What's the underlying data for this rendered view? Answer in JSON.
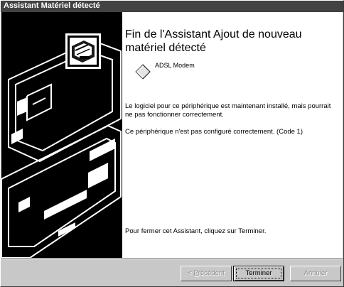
{
  "window": {
    "title": "Assistant Matériel détecté"
  },
  "main": {
    "heading": "Fin de l'Assistant Ajout de nouveau matériel détecté",
    "device_name": "ADSL Modem",
    "paragraph1": "Le logiciel pour ce périphérique est maintenant installé, mais pourrait ne pas fonctionner correctement.",
    "paragraph2": "Ce périphérique n'est pas configuré correctement. (Code 1)",
    "paragraph3": "Pour fermer cet Assistant, cliquez sur Terminer."
  },
  "buttons": {
    "back_prefix": "< ",
    "back_mnemonic": "P",
    "back_rest": "récédent",
    "finish_label": "Terminer",
    "cancel_label": "Annuler"
  },
  "icons": {
    "wizard_graphic": "hardware-computer-graphic",
    "wizard_badge": "hardware-card-icon",
    "device": "diamond-device-icon"
  },
  "colors": {
    "titlebar": "#424242",
    "panel": "#000000",
    "face": "#c8c8c8"
  }
}
